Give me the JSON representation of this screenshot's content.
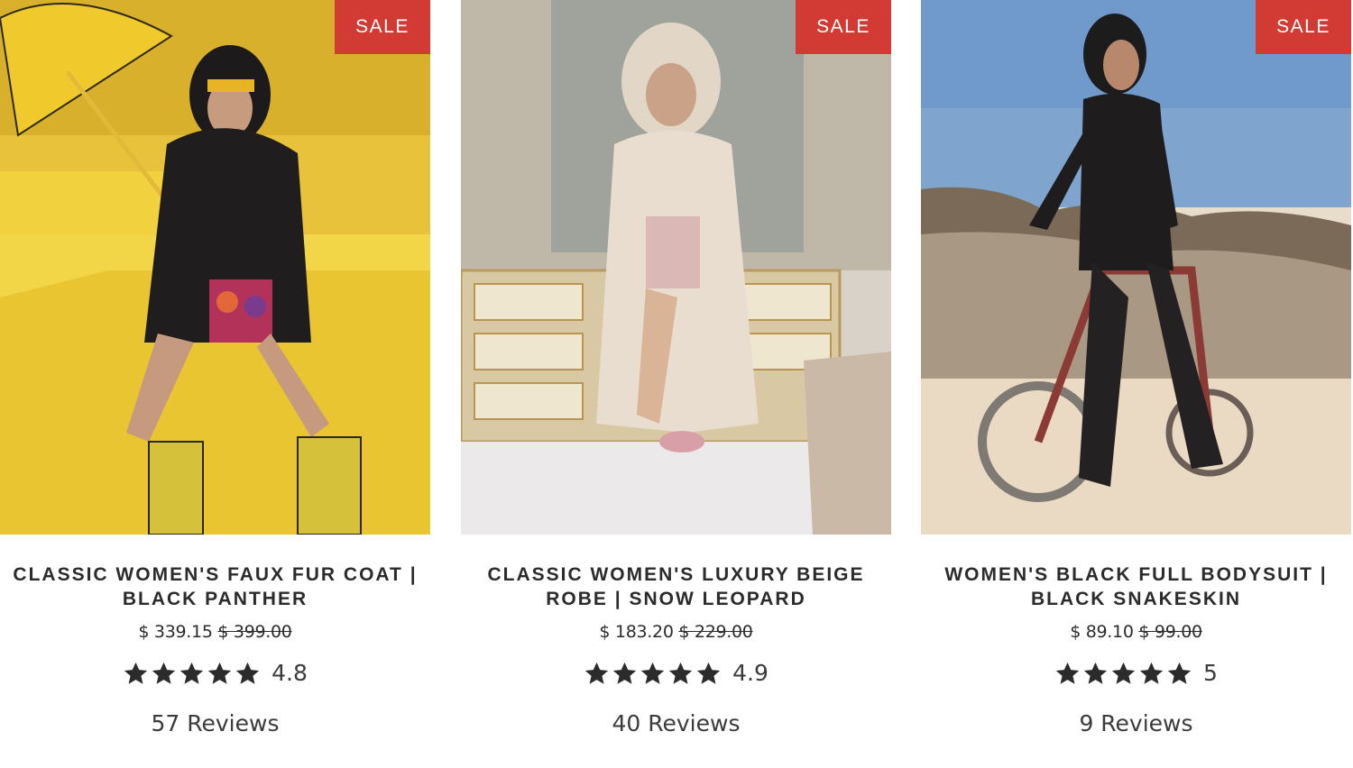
{
  "products": [
    {
      "sale_badge": "SALE",
      "title_line1": "CLASSIC WOMEN'S FAUX FUR COAT |",
      "title_line2": "BLACK PANTHER",
      "price": "$ 339.15",
      "compare_price": "$ 399.00",
      "rating": "4.8",
      "stars": 5,
      "reviews": "57 Reviews"
    },
    {
      "sale_badge": "SALE",
      "title_line1": "CLASSIC WOMEN'S LUXURY BEIGE",
      "title_line2": "ROBE | SNOW LEOPARD",
      "price": "$ 183.20",
      "compare_price": "$ 229.00",
      "rating": "4.9",
      "stars": 5,
      "reviews": "40 Reviews"
    },
    {
      "sale_badge": "SALE",
      "title_line1": "WOMEN'S BLACK FULL BODYSUIT |",
      "title_line2": "BLACK SNAKESKIN",
      "price": "$ 89.10",
      "compare_price": "$ 99.00",
      "rating": "5",
      "stars": 5,
      "reviews": "9 Reviews"
    }
  ],
  "colors": {
    "sale_badge": "#d23b34",
    "text": "#2b2b2b",
    "star": "#2b2b2b"
  },
  "icons": {
    "star": "star-icon"
  }
}
